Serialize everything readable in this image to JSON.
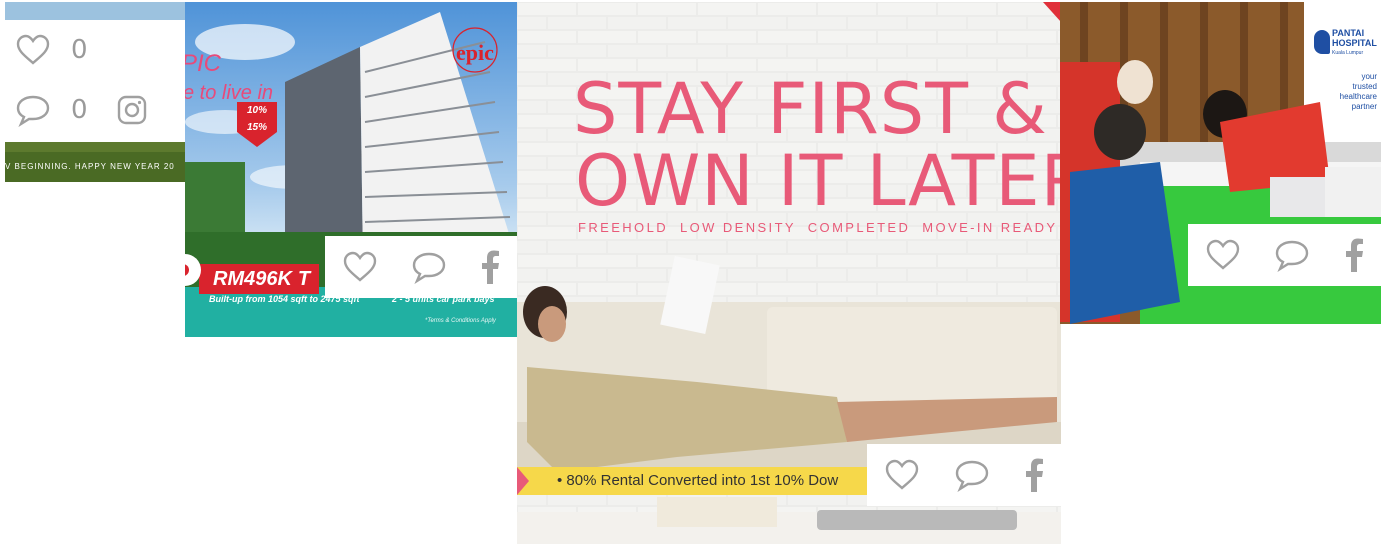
{
  "tiles": {
    "t1": {
      "caption": "V BEGINNING. HAPPY NEW YEAR 20",
      "likes": "0",
      "comments": "0",
      "icons": [
        "heart-icon",
        "comment-icon",
        "instagram-icon"
      ]
    },
    "t2": {
      "brand": "epic",
      "tagline_part1": "PIC",
      "tagline_part2": "e to live in",
      "rebate1": "10%",
      "rebate2": "15%",
      "price": "RM496K",
      "price_suffix": "T",
      "builtup": "Built-up from 1054 sqft to 2475 sqft",
      "parking": "2 - 5 units car park bays",
      "terms": "*Terms & Conditions Apply",
      "icons": [
        "heart-icon",
        "comment-icon",
        "facebook-icon"
      ]
    },
    "t3": {
      "headline1": "STAY FIRST &",
      "headline2": "OWN IT LATER",
      "features": "FREEHOLD  LOW DENSITY  COMPLETED  MOVE-IN READY",
      "banner": "• 80% Rental Converted into 1st 10% Dow",
      "icons": [
        "heart-icon",
        "comment-icon",
        "facebook-icon"
      ]
    },
    "t4": {
      "hospital": "PANTAI HOSPITAL",
      "hospital_sub": "Kuala Lumpur",
      "slogan1": "your",
      "slogan2": "trusted",
      "slogan3": "healthcare",
      "slogan4": "partner",
      "icons": [
        "heart-icon",
        "comment-icon",
        "facebook-icon"
      ]
    }
  },
  "colors": {
    "icon_gray": "#a0a0a0",
    "headline_pink": "#e85a78",
    "banner_yellow": "#f6d84a",
    "epic_red": "#d9232d",
    "teal": "#21b0a2"
  }
}
